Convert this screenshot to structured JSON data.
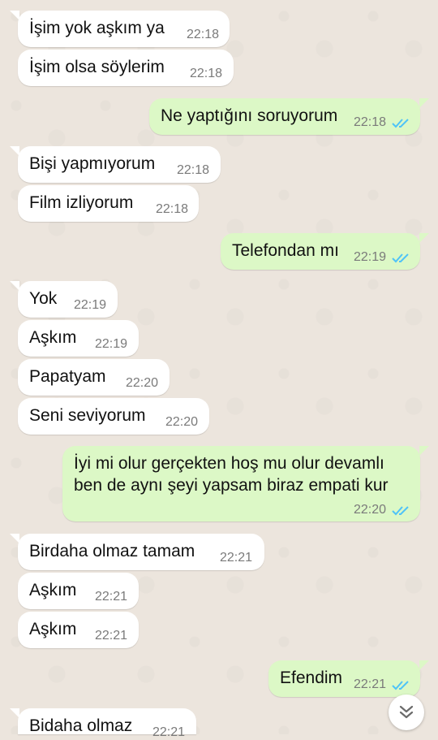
{
  "messages": [
    {
      "dir": "in",
      "text": "İşim yok aşkım ya",
      "time": "22:18"
    },
    {
      "dir": "in",
      "text": "İşim olsa söylerim",
      "time": "22:18"
    },
    {
      "dir": "out",
      "text": "Ne yaptığını soruyorum",
      "time": "22:18",
      "status": "read"
    },
    {
      "dir": "in",
      "text": "Bişi yapmıyorum",
      "time": "22:18"
    },
    {
      "dir": "in",
      "text": "Film izliyorum",
      "time": "22:18"
    },
    {
      "dir": "out",
      "text": "Telefondan mı",
      "time": "22:19",
      "status": "read"
    },
    {
      "dir": "in",
      "text": "Yok",
      "time": "22:19"
    },
    {
      "dir": "in",
      "text": "Aşkım",
      "time": "22:19"
    },
    {
      "dir": "in",
      "text": "Papatyam",
      "time": "22:20"
    },
    {
      "dir": "in",
      "text": "Seni seviyorum",
      "time": "22:20"
    },
    {
      "dir": "out",
      "text": "İyi mi olur gerçekten hoş mu olur devamlı ben de aynı şeyi yapsam biraz empati kur",
      "time": "22:20",
      "status": "read"
    },
    {
      "dir": "in",
      "text": "Birdaha olmaz tamam",
      "time": "22:21"
    },
    {
      "dir": "in",
      "text": "Aşkım",
      "time": "22:21"
    },
    {
      "dir": "in",
      "text": "Aşkım",
      "time": "22:21"
    },
    {
      "dir": "out",
      "text": "Efendim",
      "time": "22:21",
      "status": "read"
    },
    {
      "dir": "in",
      "text": "Bidaha olmaz",
      "time": "22:21"
    }
  ],
  "scroll_button": {
    "icon": "double-chevron-down-icon"
  },
  "colors": {
    "incoming_bubble": "#ffffff",
    "outgoing_bubble": "#dcf8c6",
    "read_ticks": "#4fc3f7",
    "background": "#ece5dd"
  }
}
